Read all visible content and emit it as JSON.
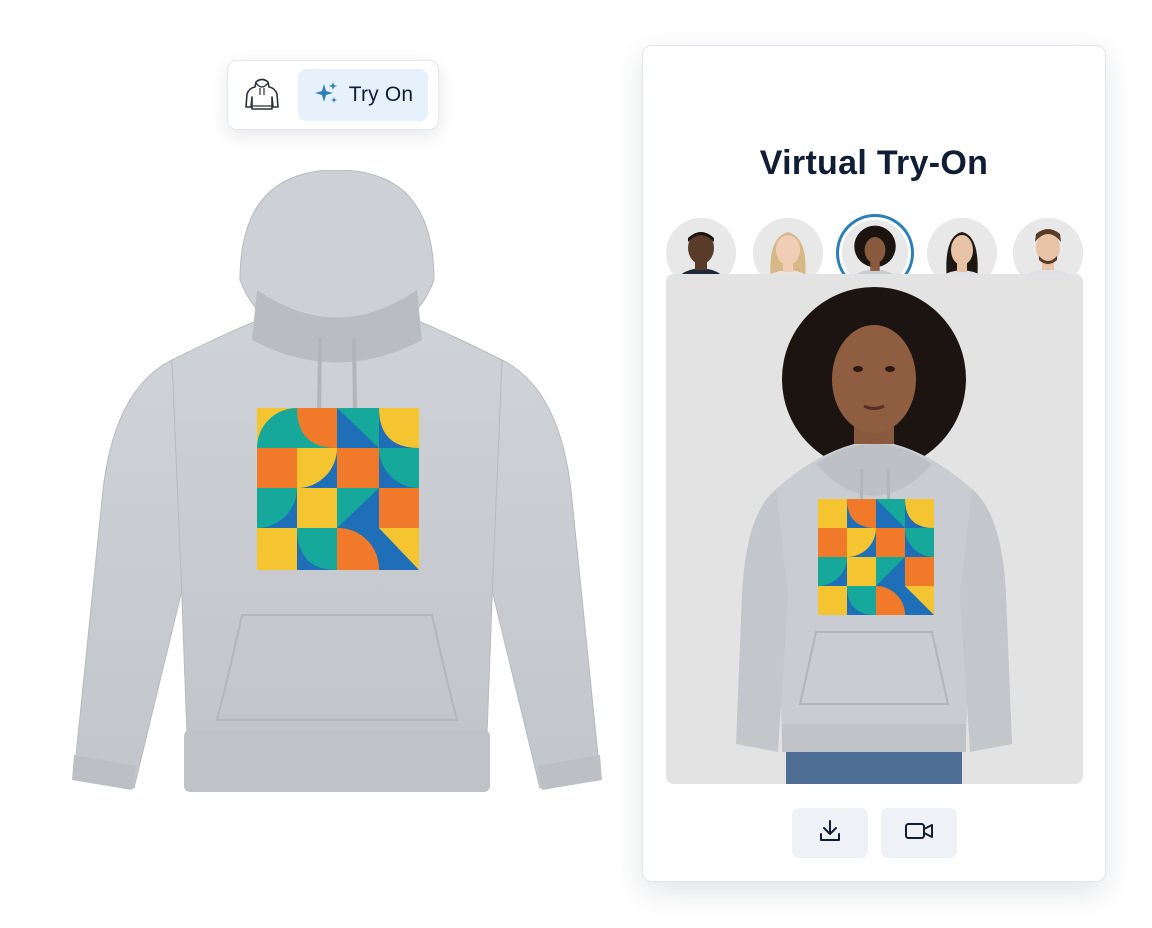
{
  "toolbar": {
    "garment_icon": "hoodie-icon",
    "tryon_icon": "sparkles-icon",
    "tryon_label": "Try On"
  },
  "panel": {
    "title": "Virtual Try-On",
    "models": [
      {
        "name": "model-1",
        "skin": "#5a3a28",
        "hair": "#1a1410",
        "shirt": "#1e2a3c",
        "selected": false
      },
      {
        "name": "model-2",
        "skin": "#f0cdb4",
        "hair": "#d6b887",
        "shirt": "#ede6de",
        "selected": false
      },
      {
        "name": "model-3",
        "skin": "#8a5a3e",
        "hair": "#1b1411",
        "shirt": "#c9ccd0",
        "selected": true
      },
      {
        "name": "model-4",
        "skin": "#e6c2a6",
        "hair": "#1f1712",
        "shirt": "#dfe2e6",
        "selected": false
      },
      {
        "name": "model-5",
        "skin": "#e9c4a6",
        "hair": "#5a3b26",
        "shirt": "#dfe1e4",
        "selected": false
      }
    ],
    "actions": [
      {
        "name": "download-button",
        "icon": "download-icon"
      },
      {
        "name": "video-button",
        "icon": "video-icon"
      }
    ]
  },
  "colors": {
    "accent": "#2a7fb8",
    "hoodie": "#c9ccd0",
    "print_blue": "#1f6fb8",
    "print_orange": "#f07a2a",
    "print_yellow": "#f4c431",
    "print_teal": "#16a89a"
  }
}
